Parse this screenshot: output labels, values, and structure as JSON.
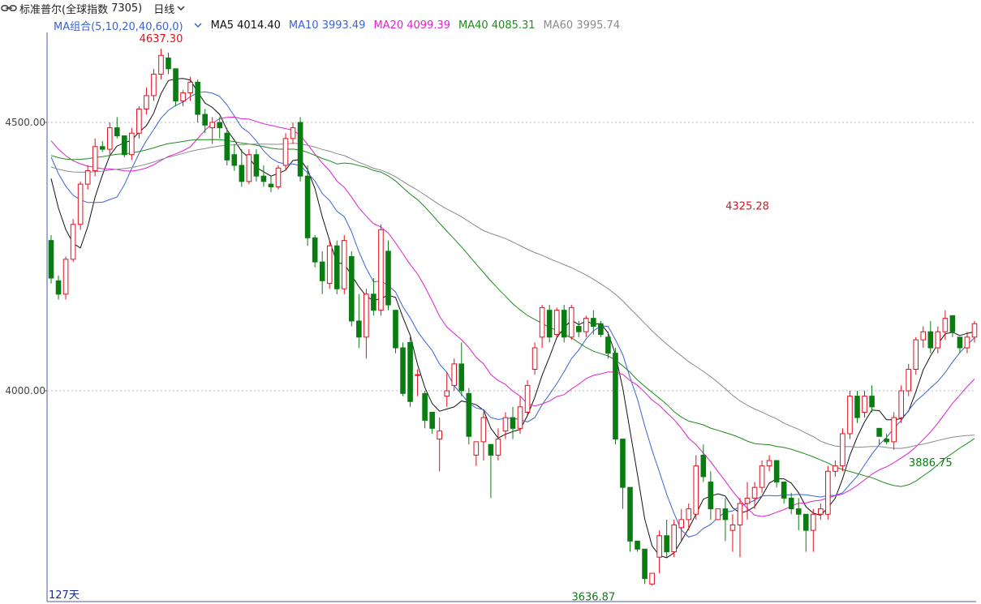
{
  "header": {
    "title": "标准普尔(全球指数",
    "code": "7305)",
    "period": "日线"
  },
  "ma_legend": {
    "combo": "MA组合(5,10,20,40,60,0)",
    "ma5": "MA5 4014.40",
    "ma10": "MA10 3993.49",
    "ma20": "MA20 4099.39",
    "ma40": "MA40 4085.31",
    "ma60": "MA60 3995.74"
  },
  "colors": {
    "up": "#e0101f",
    "down": "#0a7d12",
    "ma5": "#111111",
    "ma10": "#3a63d8",
    "ma20": "#e020d0",
    "ma40": "#1e8c1e",
    "ma60": "#8a8a8a",
    "grid": "#b8b8b8",
    "axis": "#4a5aa8"
  },
  "footer": {
    "days": "127天"
  },
  "chart_data": {
    "type": "candlestick",
    "y_ticks": [
      {
        "value": 4500,
        "label": "4500.00"
      },
      {
        "value": 4000,
        "label": "4000.00"
      }
    ],
    "ylim": [
      3620,
      4680
    ],
    "annotations": [
      {
        "label": "4637.30",
        "value": 4637.3,
        "index": 15,
        "color": "up"
      },
      {
        "label": "4325.28",
        "value": 4325.28,
        "index": 95,
        "color": "up"
      },
      {
        "label": "3636.87",
        "value": 3636.87,
        "index": 74,
        "color": "down"
      },
      {
        "label": "3886.75",
        "value": 3886.75,
        "index": 120,
        "color": "down"
      }
    ],
    "ohlc": [
      [
        4280,
        4290,
        4200,
        4210
      ],
      [
        4205,
        4215,
        4170,
        4180
      ],
      [
        4180,
        4250,
        4170,
        4245
      ],
      [
        4245,
        4320,
        4240,
        4310
      ],
      [
        4310,
        4390,
        4300,
        4385
      ],
      [
        4385,
        4420,
        4375,
        4410
      ],
      [
        4410,
        4470,
        4400,
        4455
      ],
      [
        4455,
        4465,
        4445,
        4450
      ],
      [
        4450,
        4500,
        4440,
        4490
      ],
      [
        4490,
        4510,
        4470,
        4475
      ],
      [
        4475,
        4445,
        4435,
        4440
      ],
      [
        4440,
        4490,
        4430,
        4480
      ],
      [
        4480,
        4530,
        4470,
        4525
      ],
      [
        4525,
        4565,
        4515,
        4550
      ],
      [
        4550,
        4600,
        4540,
        4590
      ],
      [
        4590,
        4637,
        4580,
        4625
      ],
      [
        4620,
        4630,
        4590,
        4600
      ],
      [
        4600,
        4590,
        4530,
        4540
      ],
      [
        4540,
        4560,
        4530,
        4555
      ],
      [
        4555,
        4585,
        4540,
        4575
      ],
      [
        4575,
        4580,
        4500,
        4515
      ],
      [
        4515,
        4525,
        4480,
        4495
      ],
      [
        4490,
        4510,
        4460,
        4500
      ],
      [
        4500,
        4510,
        4470,
        4490
      ],
      [
        4480,
        4490,
        4420,
        4430
      ],
      [
        4440,
        4460,
        4410,
        4420
      ],
      [
        4420,
        4450,
        4380,
        4390
      ],
      [
        4390,
        4450,
        4385,
        4440
      ],
      [
        4440,
        4450,
        4390,
        4400
      ],
      [
        4400,
        4420,
        4380,
        4390
      ],
      [
        4385,
        4400,
        4370,
        4380
      ],
      [
        4380,
        4420,
        4375,
        4415
      ],
      [
        4420,
        4480,
        4410,
        4470
      ],
      [
        4470,
        4500,
        4460,
        4490
      ],
      [
        4500,
        4510,
        4390,
        4400
      ],
      [
        4400,
        4420,
        4270,
        4285
      ],
      [
        4285,
        4290,
        4230,
        4240
      ],
      [
        4240,
        4260,
        4180,
        4205
      ],
      [
        4200,
        4280,
        4190,
        4270
      ],
      [
        4270,
        4280,
        4180,
        4190
      ],
      [
        4190,
        4290,
        4180,
        4280
      ],
      [
        4250,
        4260,
        4120,
        4130
      ],
      [
        4130,
        4180,
        4080,
        4100
      ],
      [
        4100,
        4190,
        4060,
        4180
      ],
      [
        4180,
        4210,
        4140,
        4150
      ],
      [
        4150,
        4310,
        4140,
        4300
      ],
      [
        4260,
        4280,
        4150,
        4160
      ],
      [
        4150,
        4130,
        4070,
        4080
      ],
      [
        4080,
        4090,
        3990,
        3995
      ],
      [
        4090,
        4100,
        3970,
        3980
      ],
      [
        4030,
        4040,
        3990,
        4030
      ],
      [
        3995,
        4000,
        3930,
        3945
      ],
      [
        3960,
        3950,
        3920,
        3930
      ],
      [
        3910,
        3950,
        3850,
        3925
      ],
      [
        3990,
        4035,
        3970,
        4000
      ],
      [
        4010,
        4060,
        4000,
        4050
      ],
      [
        4050,
        4090,
        3990,
        4000
      ],
      [
        3995,
        4005,
        3900,
        3915
      ],
      [
        3880,
        3900,
        3860,
        3905
      ],
      [
        3905,
        3960,
        3870,
        3950
      ],
      [
        3900,
        3890,
        3800,
        3880
      ],
      [
        3880,
        3930,
        3870,
        3910
      ],
      [
        3925,
        3960,
        3910,
        3950
      ],
      [
        3950,
        3970,
        3910,
        3930
      ],
      [
        3930,
        3990,
        3920,
        3970
      ],
      [
        3960,
        4020,
        3955,
        4010
      ],
      [
        4040,
        4090,
        4030,
        4080
      ],
      [
        4100,
        4160,
        4080,
        4155
      ],
      [
        4150,
        4160,
        4090,
        4100
      ],
      [
        4105,
        4155,
        4100,
        4150
      ],
      [
        4150,
        4160,
        4090,
        4100
      ],
      [
        4100,
        4160,
        4095,
        4155
      ],
      [
        4120,
        4130,
        4100,
        4110
      ],
      [
        4110,
        4140,
        4100,
        4135
      ],
      [
        4135,
        4150,
        4105,
        4120
      ],
      [
        4125,
        4130,
        4100,
        4105
      ],
      [
        4100,
        4110,
        4060,
        4070
      ],
      [
        4070,
        4080,
        3900,
        3910
      ],
      [
        3910,
        3890,
        3780,
        3820
      ],
      [
        3820,
        3800,
        3700,
        3720
      ],
      [
        3720,
        3720,
        3700,
        3705
      ],
      [
        3705,
        3700,
        3640,
        3650
      ],
      [
        3640,
        3660,
        3637,
        3660
      ],
      [
        3690,
        3740,
        3660,
        3730
      ],
      [
        3730,
        3760,
        3690,
        3700
      ],
      [
        3700,
        3760,
        3690,
        3750
      ],
      [
        3745,
        3780,
        3720,
        3760
      ],
      [
        3760,
        3790,
        3740,
        3780
      ],
      [
        3770,
        3880,
        3760,
        3860
      ],
      [
        3880,
        3900,
        3830,
        3840
      ],
      [
        3830,
        3850,
        3760,
        3780
      ],
      [
        3760,
        3780,
        3760,
        3780
      ],
      [
        3780,
        3800,
        3720,
        3760
      ],
      [
        3740,
        3770,
        3700,
        3750
      ],
      [
        3750,
        3800,
        3690,
        3790
      ],
      [
        3790,
        3830,
        3760,
        3800
      ],
      [
        3800,
        3830,
        3780,
        3820
      ],
      [
        3820,
        3870,
        3810,
        3860
      ],
      [
        3860,
        3880,
        3850,
        3870
      ],
      [
        3870,
        3860,
        3820,
        3830
      ],
      [
        3830,
        3820,
        3790,
        3800
      ],
      [
        3800,
        3810,
        3770,
        3780
      ],
      [
        3780,
        3800,
        3740,
        3770
      ],
      [
        3770,
        3760,
        3700,
        3740
      ]
    ],
    "ma_lines": {
      "note_series": [
        "MA5",
        "MA10",
        "MA20",
        "MA40",
        "MA60"
      ]
    }
  }
}
